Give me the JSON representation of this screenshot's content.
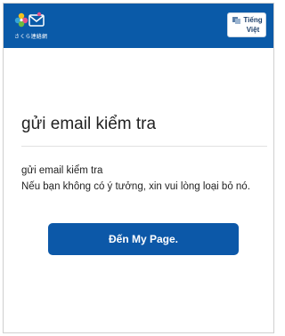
{
  "header": {
    "logo_text": "さくら連絡網",
    "language_button": "Tiếng\nViệt"
  },
  "main": {
    "title": "gửi email kiểm tra",
    "message_line1": "gửi email kiểm tra",
    "message_line2": "Nếu bạn không có ý tưởng, xin vui lòng loại bỏ nó.",
    "mypage_button": "Đến My Page."
  },
  "icons": {
    "logo": "sakura-logo-icon",
    "language": "translate-icon"
  },
  "colors": {
    "header_bg": "#0a5aa8",
    "button_bg": "#0c58a8",
    "text": "#222222",
    "divider": "#e2e2e2"
  }
}
